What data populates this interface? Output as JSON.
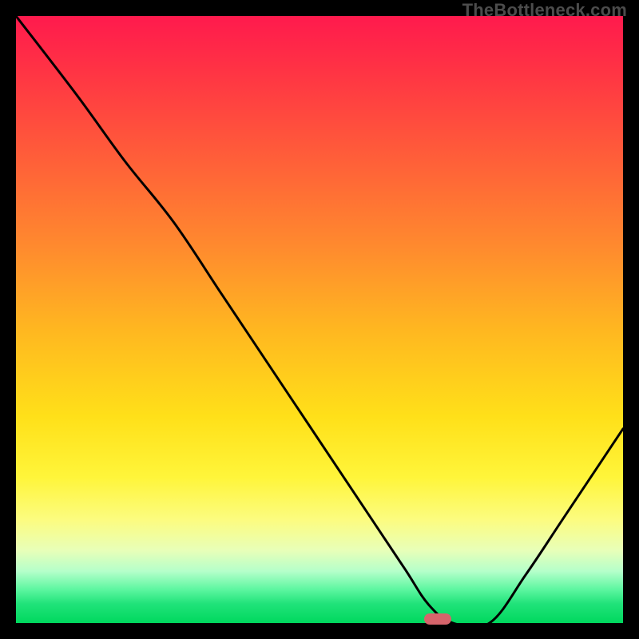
{
  "watermark": "TheBottleneck.com",
  "marker": {
    "x_frac": 0.695,
    "y_frac": 0.993
  },
  "chart_data": {
    "type": "line",
    "title": "",
    "xlabel": "",
    "ylabel": "",
    "xlim": [
      0,
      1
    ],
    "ylim": [
      0,
      1
    ],
    "series": [
      {
        "name": "curve",
        "x": [
          0.0,
          0.1,
          0.18,
          0.26,
          0.34,
          0.42,
          0.5,
          0.58,
          0.64,
          0.68,
          0.72,
          0.78,
          0.84,
          0.9,
          0.96,
          1.0
        ],
        "y": [
          1.0,
          0.87,
          0.76,
          0.66,
          0.54,
          0.42,
          0.3,
          0.18,
          0.09,
          0.03,
          0.0,
          0.0,
          0.08,
          0.17,
          0.26,
          0.32
        ]
      }
    ],
    "annotations": []
  }
}
